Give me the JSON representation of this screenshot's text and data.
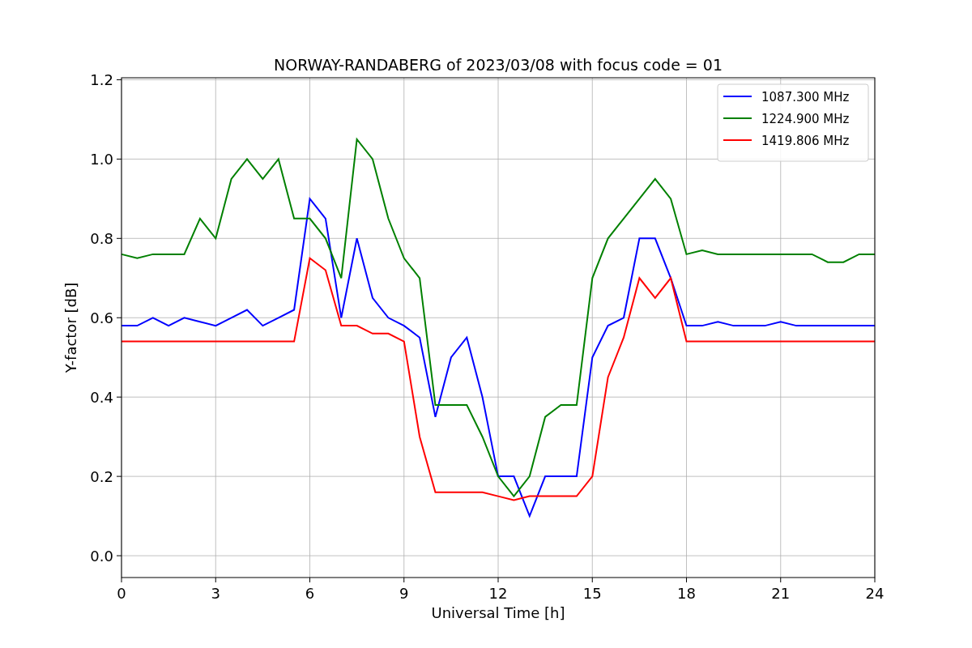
{
  "chart_data": {
    "type": "line",
    "title": "NORWAY-RANDABERG of 2023/03/08 with focus code = 01",
    "xlabel": "Universal Time [h]",
    "ylabel": "Y-factor [dB]",
    "x": [
      0,
      0.5,
      1,
      1.5,
      2,
      2.5,
      3,
      3.5,
      4,
      4.5,
      5,
      5.5,
      6,
      6.5,
      7,
      7.5,
      8,
      8.5,
      9,
      9.5,
      10,
      10.5,
      11,
      11.5,
      12,
      12.5,
      13,
      13.5,
      14,
      14.5,
      15,
      15.5,
      16,
      16.5,
      17,
      17.5,
      18,
      18.5,
      19,
      19.5,
      20,
      20.5,
      21,
      21.5,
      22,
      22.5,
      23,
      23.5,
      24
    ],
    "series": [
      {
        "name": "1087.300 MHz",
        "color": "#0000ff",
        "values": [
          0.58,
          0.58,
          0.6,
          0.58,
          0.6,
          0.59,
          0.58,
          0.6,
          0.62,
          0.58,
          0.6,
          0.62,
          0.9,
          0.85,
          0.6,
          0.8,
          0.65,
          0.6,
          0.58,
          0.55,
          0.35,
          0.5,
          0.55,
          0.4,
          0.2,
          0.2,
          0.1,
          0.2,
          0.2,
          0.2,
          0.5,
          0.58,
          0.6,
          0.8,
          0.8,
          0.7,
          0.58,
          0.58,
          0.59,
          0.58,
          0.58,
          0.58,
          0.59,
          0.58,
          0.58,
          0.58,
          0.58,
          0.58,
          0.58
        ]
      },
      {
        "name": "1224.900 MHz",
        "color": "#008000",
        "values": [
          0.76,
          0.75,
          0.76,
          0.76,
          0.76,
          0.85,
          0.8,
          0.95,
          1.0,
          0.95,
          1.0,
          0.85,
          0.85,
          0.8,
          0.7,
          1.05,
          1.0,
          0.85,
          0.75,
          0.7,
          0.38,
          0.38,
          0.38,
          0.3,
          0.2,
          0.15,
          0.2,
          0.35,
          0.38,
          0.38,
          0.7,
          0.8,
          0.85,
          0.9,
          0.95,
          0.9,
          0.76,
          0.77,
          0.76,
          0.76,
          0.76,
          0.76,
          0.76,
          0.76,
          0.76,
          0.74,
          0.74,
          0.76,
          0.76
        ]
      },
      {
        "name": "1419.806 MHz",
        "color": "#ff0000",
        "values": [
          0.54,
          0.54,
          0.54,
          0.54,
          0.54,
          0.54,
          0.54,
          0.54,
          0.54,
          0.54,
          0.54,
          0.54,
          0.75,
          0.72,
          0.58,
          0.58,
          0.56,
          0.56,
          0.54,
          0.3,
          0.16,
          0.16,
          0.16,
          0.16,
          0.15,
          0.14,
          0.15,
          0.15,
          0.15,
          0.15,
          0.2,
          0.45,
          0.55,
          0.7,
          0.65,
          0.7,
          0.54,
          0.54,
          0.54,
          0.54,
          0.54,
          0.54,
          0.54,
          0.54,
          0.54,
          0.54,
          0.54,
          0.54,
          0.54
        ]
      }
    ],
    "grid": true,
    "legend": true,
    "xlim": [
      0,
      24
    ],
    "ylim": [
      -0.055,
      1.205
    ],
    "xticks": [
      0,
      3,
      6,
      9,
      12,
      15,
      18,
      21,
      24
    ],
    "yticks": [
      {
        "value": 0,
        "label": "0.0"
      },
      {
        "value": 0.2,
        "label": "0.2"
      },
      {
        "value": 0.4,
        "label": "0.4"
      },
      {
        "value": 0.6,
        "label": "0.6"
      },
      {
        "value": 0.8,
        "label": "0.8"
      },
      {
        "value": 1.0,
        "label": "1.0"
      },
      {
        "value": 1.2,
        "label": "1.2"
      }
    ]
  }
}
